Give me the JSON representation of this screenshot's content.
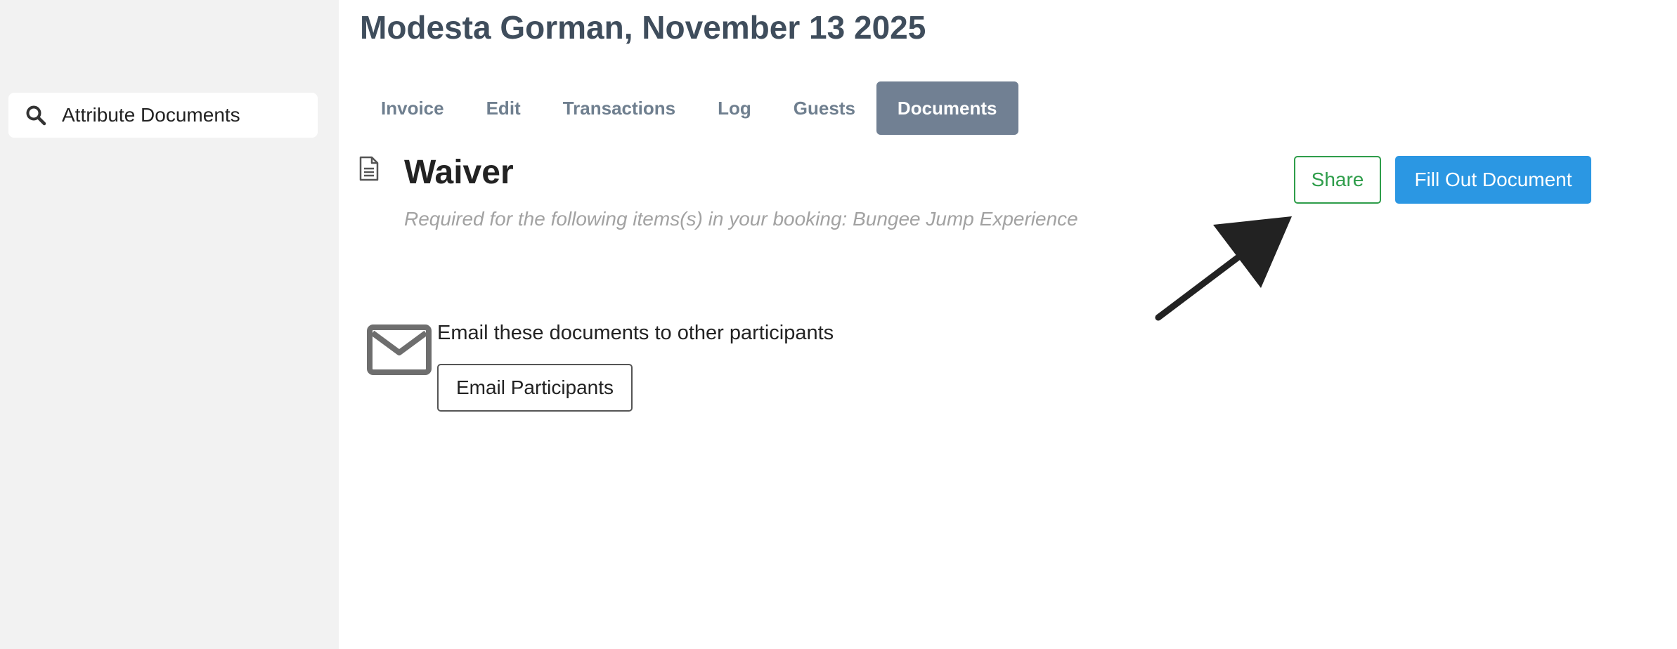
{
  "sidebar": {
    "search_item": {
      "icon": "search-icon",
      "label": "Attribute Documents"
    }
  },
  "header": {
    "title": "Modesta Gorman, November 13 2025"
  },
  "tabs": [
    {
      "label": "Invoice",
      "active": false
    },
    {
      "label": "Edit",
      "active": false
    },
    {
      "label": "Transactions",
      "active": false
    },
    {
      "label": "Log",
      "active": false
    },
    {
      "label": "Guests",
      "active": false
    },
    {
      "label": "Documents",
      "active": true
    }
  ],
  "document": {
    "icon": "document-icon",
    "title": "Waiver",
    "subtitle": "Required for the following items(s) in your booking: Bungee Jump Experience",
    "share_label": "Share",
    "fill_label": "Fill Out Document"
  },
  "annotation": {
    "icon": "arrow-pointer-icon"
  },
  "email": {
    "icon": "envelope-icon",
    "text": "Email these documents to other participants",
    "button_label": "Email Participants"
  },
  "colors": {
    "sidebar_bg": "#f2f2f2",
    "title": "#3f4d5c",
    "tab_text": "#6f7f8f",
    "tab_active_bg": "#718093",
    "share_green": "#2e9d4a",
    "primary_blue": "#2b97e3",
    "subtitle_gray": "#a2a2a2"
  }
}
